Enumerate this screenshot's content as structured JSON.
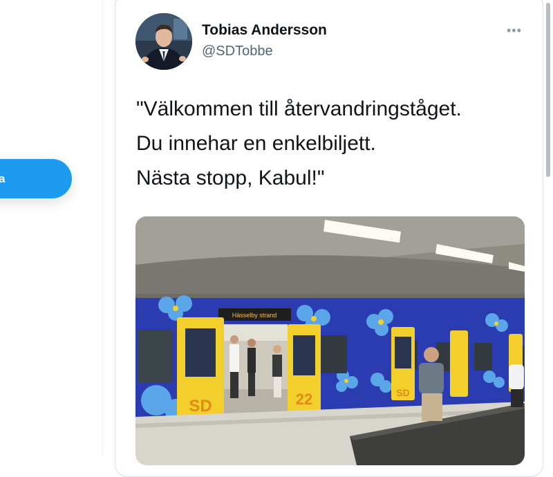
{
  "sidebar": {
    "tweet_button_label": "a"
  },
  "tweet": {
    "author_name": "Tobias Andersson",
    "author_handle": "@SDTobbe",
    "more_icon": "more-icon",
    "text_lines": [
      "\"Välkommen till återvandringståget.",
      "Du innehar en enkelbiljett.",
      "Nästa stopp, Kabul!\""
    ],
    "media": {
      "destination_sign": "Hässelby strand",
      "door_logo_left": "SD",
      "door_logo_right": "SD",
      "door_number": "22",
      "colors": {
        "train_body": "#2a3cb0",
        "door_yellow": "#f2cf2b",
        "flower_blue": "#5aa6e8"
      }
    }
  },
  "colors": {
    "accent": "#1d9bf0",
    "text": "#0f1419",
    "secondary": "#536471"
  }
}
